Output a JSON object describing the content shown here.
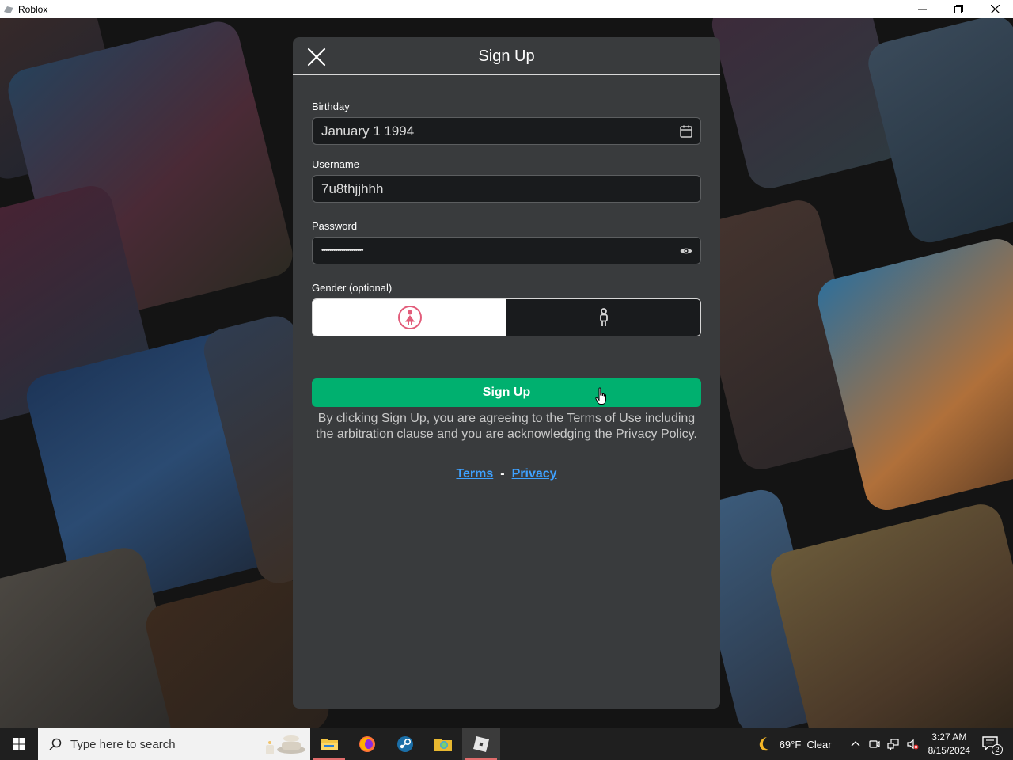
{
  "window": {
    "title": "Roblox"
  },
  "dialog": {
    "title": "Sign Up",
    "birthday": {
      "label": "Birthday",
      "value": "January 1 1994"
    },
    "username": {
      "label": "Username",
      "value": "7u8thjjhhh"
    },
    "password": {
      "label": "Password",
      "value": "•••••••••••••••••••••"
    },
    "gender": {
      "label": "Gender (optional)",
      "selected": "female"
    },
    "submit_label": "Sign Up",
    "legal_text": "By clicking Sign Up, you are agreeing to the Terms of Use including the arbitration clause and you are acknowledging the Privacy Policy.",
    "links": {
      "terms": "Terms",
      "separator": "-",
      "privacy": "Privacy"
    },
    "colors": {
      "primary": "#00b06f",
      "link": "#3ea1ff",
      "panel": "#393b3d"
    }
  },
  "taskbar": {
    "search_placeholder": "Type here to search",
    "weather": {
      "temp": "69°F",
      "condition": "Clear"
    },
    "clock": {
      "time": "3:27 AM",
      "date": "8/15/2024"
    },
    "notification_count": "2",
    "apps": [
      "file-explorer-icon",
      "firefox-icon",
      "steam-icon",
      "folder-app-icon",
      "roblox-icon"
    ]
  }
}
